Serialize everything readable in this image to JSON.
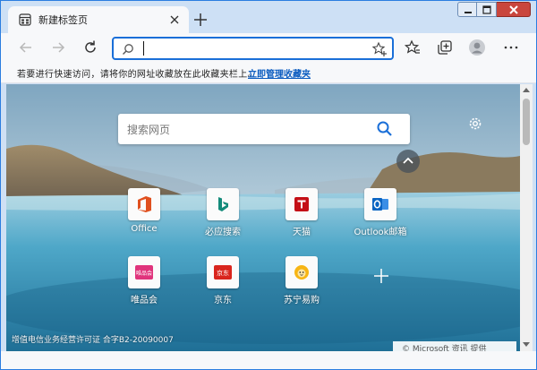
{
  "window": {
    "tab_title": "新建标签页",
    "accent_color": "#1a6fd8"
  },
  "toolbar": {
    "address_value": "",
    "icons": [
      "back-icon",
      "forward-icon",
      "refresh-icon",
      "search-icon",
      "add-favorite-icon",
      "favorites-icon",
      "collections-icon",
      "profile-icon",
      "more-icon"
    ]
  },
  "favorites_bar": {
    "hint": "若要进行快速访问，请将你的网址收藏放在此收藏夹栏上。",
    "manage_link": "立即管理收藏夹"
  },
  "newtab": {
    "search_placeholder": "搜索网页",
    "tiles": [
      {
        "label": "Office",
        "icon": "office-icon"
      },
      {
        "label": "必应搜索",
        "icon": "bing-icon"
      },
      {
        "label": "天猫",
        "icon": "tmall-icon"
      },
      {
        "label": "Outlook邮箱",
        "icon": "outlook-icon"
      },
      {
        "label": "唯品会",
        "icon": "vipshop-icon",
        "icon_text": "唯品会"
      },
      {
        "label": "京东",
        "icon": "jd-icon",
        "icon_text": "京东"
      },
      {
        "label": "苏宁易购",
        "icon": "suning-icon"
      }
    ],
    "license": "增值电信业务经营许可证  合字B2-20090007",
    "badge": "© Microsoft 资讯 提供"
  }
}
